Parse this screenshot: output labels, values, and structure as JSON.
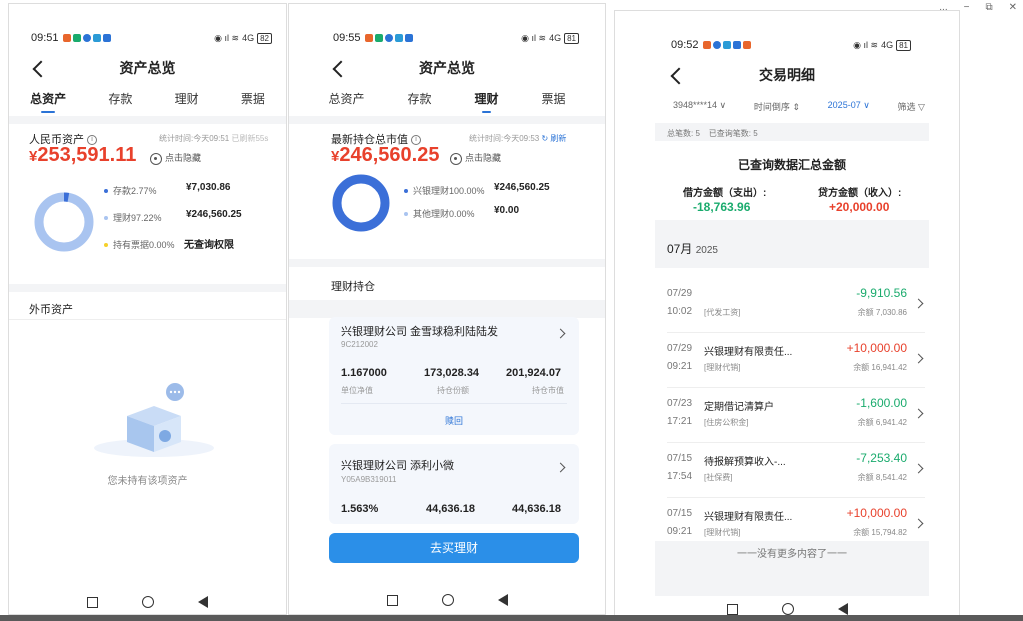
{
  "window": {
    "more": "...",
    "min": "−",
    "restore": "⧉",
    "close": "✕"
  },
  "phone1": {
    "status": {
      "time": "09:51",
      "signal": "4G",
      "battery": "82"
    },
    "title": "资产总览",
    "tabs": [
      "总资产",
      "存款",
      "理财",
      "票据"
    ],
    "rmb_label": "人民币资产",
    "stat_time": "统计时间:今天09:51",
    "refreshed": "已刷新55s",
    "total": "253,591.11",
    "currency": "¥",
    "hide": "点击隐藏",
    "items": [
      {
        "label": "存款2.77%",
        "value": "¥7,030.86",
        "color": "#3b6fd8"
      },
      {
        "label": "理财97.22%",
        "value": "¥246,560.25",
        "color": "#a9c4f0"
      },
      {
        "label": "持有票据0.00%",
        "value": "无查询权限",
        "color": "#f5d02a"
      }
    ],
    "foreign_label": "外币资产",
    "empty": "您未持有该项资产"
  },
  "phone2": {
    "status": {
      "time": "09:55",
      "signal": "4G",
      "battery": "81"
    },
    "title": "资产总览",
    "tabs": [
      "总资产",
      "存款",
      "理财",
      "票据"
    ],
    "latest_label": "最新持仓总市值",
    "stat_time": "统计时间:今天09:53",
    "refresh": "刷新",
    "total": "246,560.25",
    "currency": "¥",
    "hide": "点击隐藏",
    "items": [
      {
        "label": "兴银理财100.00%",
        "value": "¥246,560.25",
        "color": "#3b6fd8"
      },
      {
        "label": "其他理财0.00%",
        "value": "¥0.00",
        "color": "#a9c4f0"
      }
    ],
    "section": "理财持仓",
    "products": [
      {
        "name": "兴银理财公司 金雪球稳利陆陆发",
        "code": "9C212002",
        "nav": "1.167000",
        "nav_label": "单位净值",
        "shares": "173,028.34",
        "shares_label": "持仓份额",
        "mv": "201,924.07",
        "mv_label": "持仓市值",
        "action": "赎回"
      },
      {
        "name": "兴银理财公司 添利小微",
        "code": "Y05A9B319011",
        "nav": "1.563%",
        "shares": "44,636.18",
        "mv": "44,636.18"
      }
    ],
    "buy": "去买理财"
  },
  "phone3": {
    "status": {
      "time": "09:52",
      "signal": "4G",
      "battery": "81"
    },
    "title": "交易明细",
    "filters": {
      "account": "3948****14",
      "order": "时间倒序",
      "month": "2025-07",
      "filter": "筛选"
    },
    "counts": {
      "total": "总笔数: 5",
      "queried": "已查询笔数: 5"
    },
    "summary_title": "已查询数据汇总金额",
    "debit_label": "借方金额（支出）:",
    "debit": "-18,763.96",
    "credit_label": "贷方金额（收入）:",
    "credit": "+20,000.00",
    "month_label": "07月",
    "year": "2025",
    "rows": [
      {
        "date": "07/29",
        "time": "10:02",
        "name": "",
        "tag": "[代发工资]",
        "amount": "-9,910.56",
        "balance": "余额 7,030.86",
        "sign": "neg"
      },
      {
        "date": "07/29",
        "time": "09:21",
        "name": "兴银理财有限责任...",
        "tag": "[理财代销]",
        "amount": "+10,000.00",
        "balance": "余额 16,941.42",
        "sign": "pos"
      },
      {
        "date": "07/23",
        "time": "17:21",
        "name": "定期借记清算户",
        "tag": "[住房公积金]",
        "amount": "-1,600.00",
        "balance": "余额 6,941.42",
        "sign": "neg"
      },
      {
        "date": "07/15",
        "time": "17:54",
        "name": "待报解预算收入-...",
        "tag": "[社保费]",
        "amount": "-7,253.40",
        "balance": "余额 8,541.42",
        "sign": "neg"
      },
      {
        "date": "07/15",
        "time": "09:21",
        "name": "兴银理财有限责任...",
        "tag": "[理财代销]",
        "amount": "+10,000.00",
        "balance": "余额 15,794.82",
        "sign": "pos"
      }
    ],
    "nomore": "一一没有更多内容了一一"
  }
}
